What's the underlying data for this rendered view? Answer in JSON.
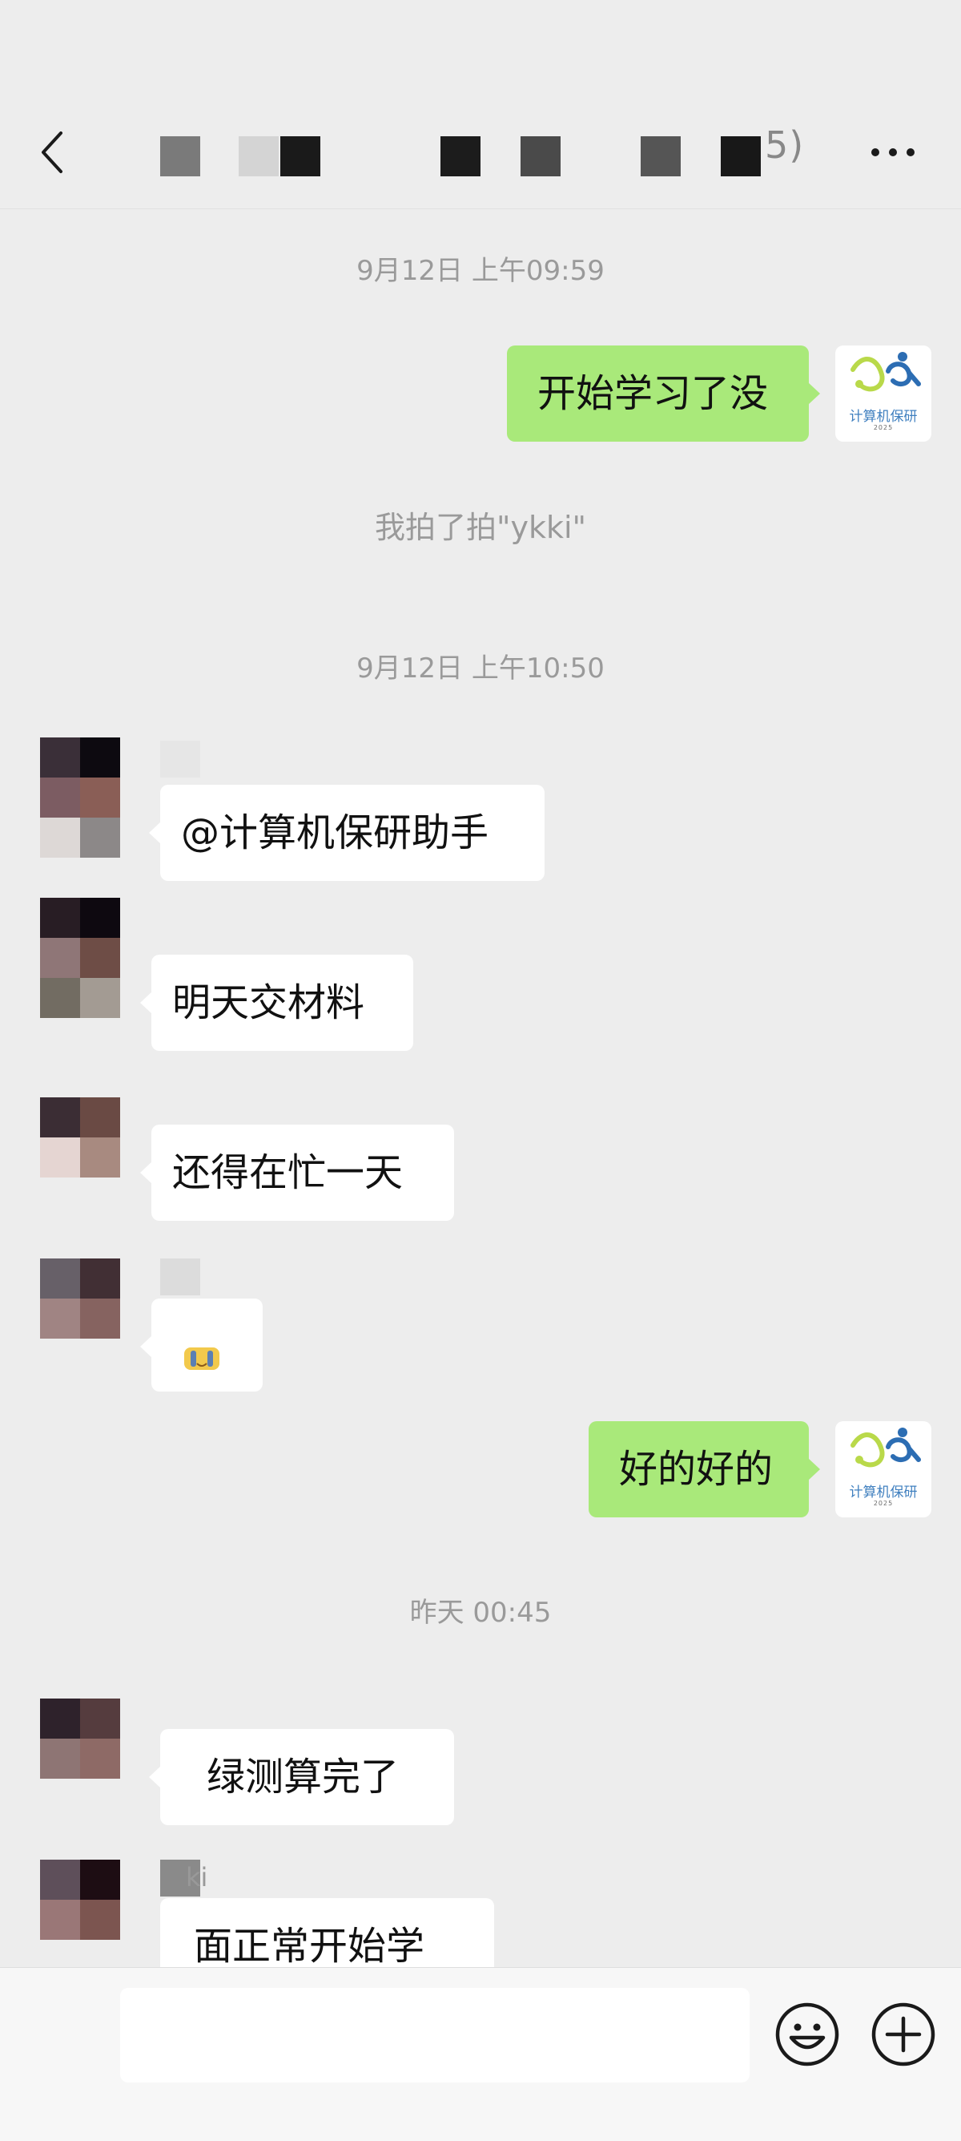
{
  "header": {
    "title_visible_suffix": "5)",
    "back_icon": "chevron-left-icon",
    "more_icon": "more-horizontal-icon"
  },
  "messages": {
    "time_1": "9月12日 上午09:59",
    "mine_1": "开始学习了没",
    "system_1": "我拍了拍\"ykki\"",
    "time_2": "9月12日 上午10:50",
    "other_1": "@计算机保研助手",
    "other_2": "明天交材料",
    "other_3": "还得在忙一天",
    "mine_2": "好的好的",
    "time_3": "昨天 00:45",
    "other_5": "绿测算完了",
    "other_6_name": "ki",
    "other_6": "面正常开始学"
  },
  "avatar_mine": {
    "logo_text": "计算机保研",
    "logo_year": "2025"
  },
  "input": {
    "emoji_icon": "emoji-smile-icon",
    "plus_icon": "plus-circle-icon"
  },
  "colors": {
    "background": "#ededed",
    "my_bubble": "#a9e97a",
    "other_bubble": "#ffffff",
    "timestamp_text": "#9a9a9a"
  }
}
